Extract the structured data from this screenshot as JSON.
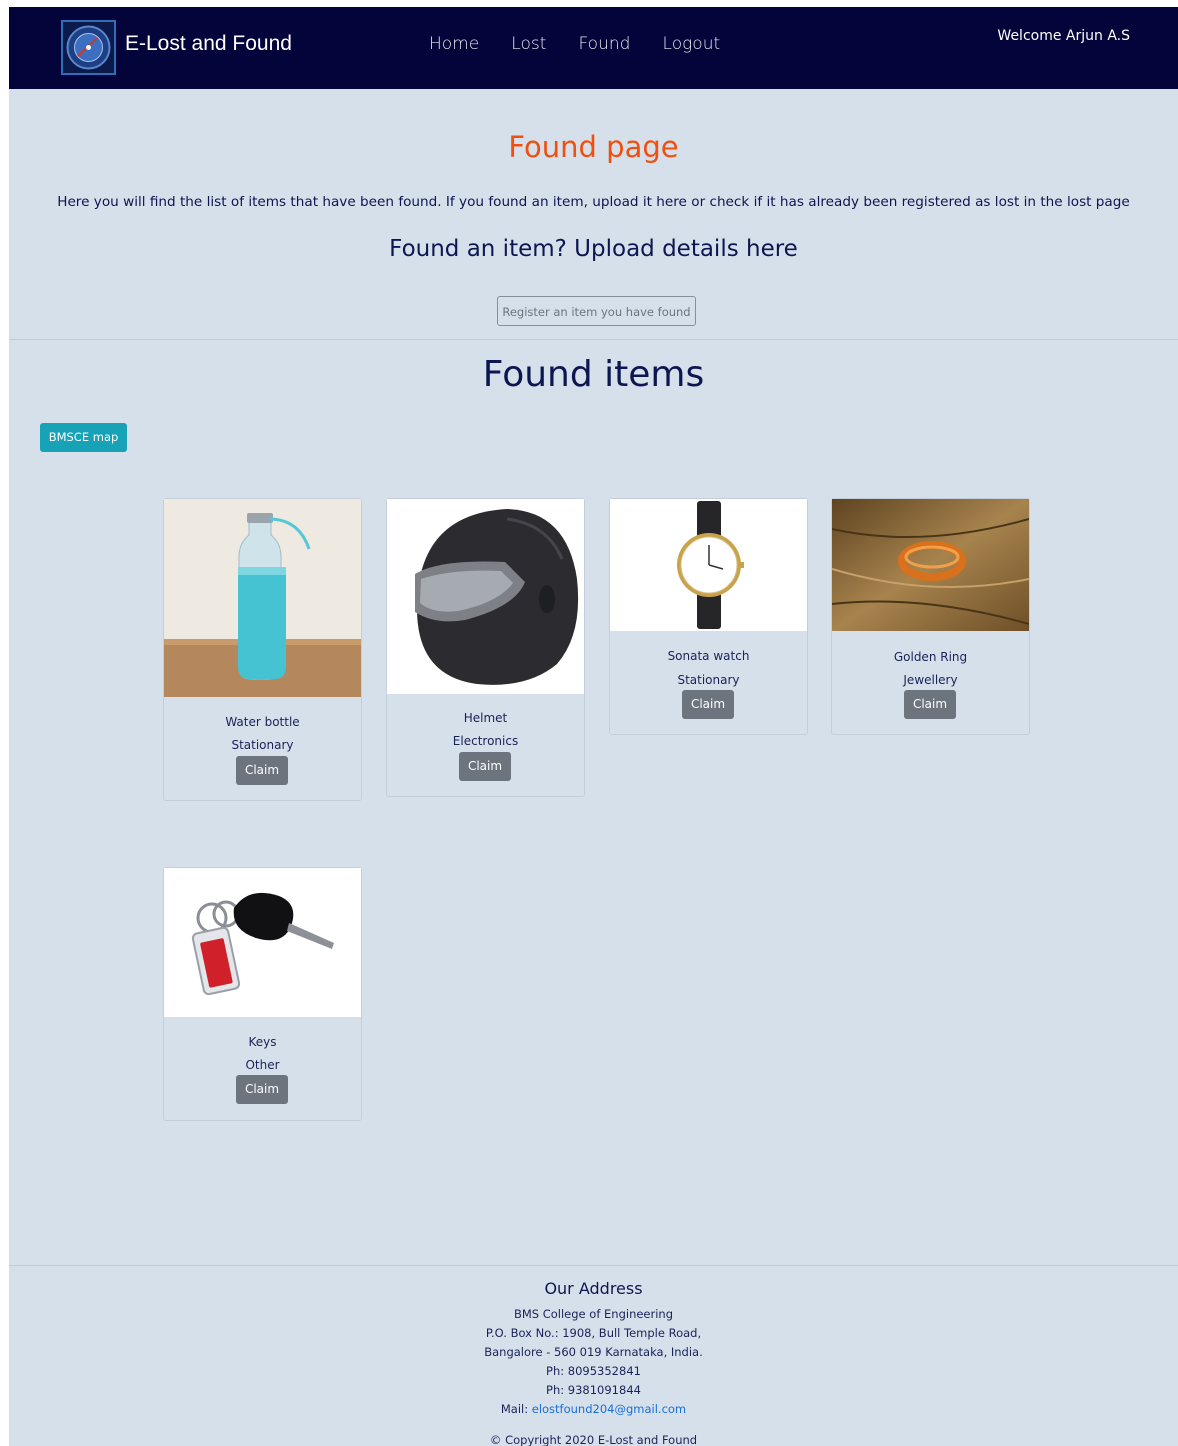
{
  "header": {
    "brand": "E-Lost and Found",
    "nav": [
      "Home",
      "Lost",
      "Found",
      "Logout"
    ],
    "welcome": "Welcome Arjun A.S"
  },
  "hero": {
    "title": "Found page",
    "description": "Here you will find the list of items that have been found. If you found an item, upload it here or check if it has already been registered as lost in the lost page",
    "upload_heading": "Found an item? Upload details here",
    "register_button": "Register an item you have found"
  },
  "items_section": {
    "title": "Found items",
    "map_button": "BMSCE map",
    "claim_label": "Claim",
    "items": [
      {
        "name": "Water bottle",
        "category": "Stationary",
        "icon": "water-bottle-image"
      },
      {
        "name": "Helmet",
        "category": "Electronics",
        "icon": "helmet-image"
      },
      {
        "name": "Sonata watch",
        "category": "Stationary",
        "icon": "watch-image"
      },
      {
        "name": "Golden Ring",
        "category": "Jewellery",
        "icon": "ring-image"
      },
      {
        "name": "Keys",
        "category": "Other",
        "icon": "keys-image"
      }
    ]
  },
  "footer": {
    "title": "Our Address",
    "lines": [
      "BMS College of Engineering",
      "P.O. Box No.: 1908, Bull Temple Road,",
      "Bangalore - 560 019 Karnataka, India.",
      "Ph: 8095352841",
      "Ph: 9381091844"
    ],
    "mail_label": "Mail: ",
    "mail": "elostfound204@gmail.com",
    "copyright": "© Copyright 2020 E-Lost and Found"
  },
  "colors": {
    "navbar": "#03043a",
    "page_background": "#d6e0ea",
    "title_accent": "#f04f0f",
    "heading": "#0d1650",
    "map_button": "#17a2b8",
    "claim_button": "#6c757d"
  }
}
